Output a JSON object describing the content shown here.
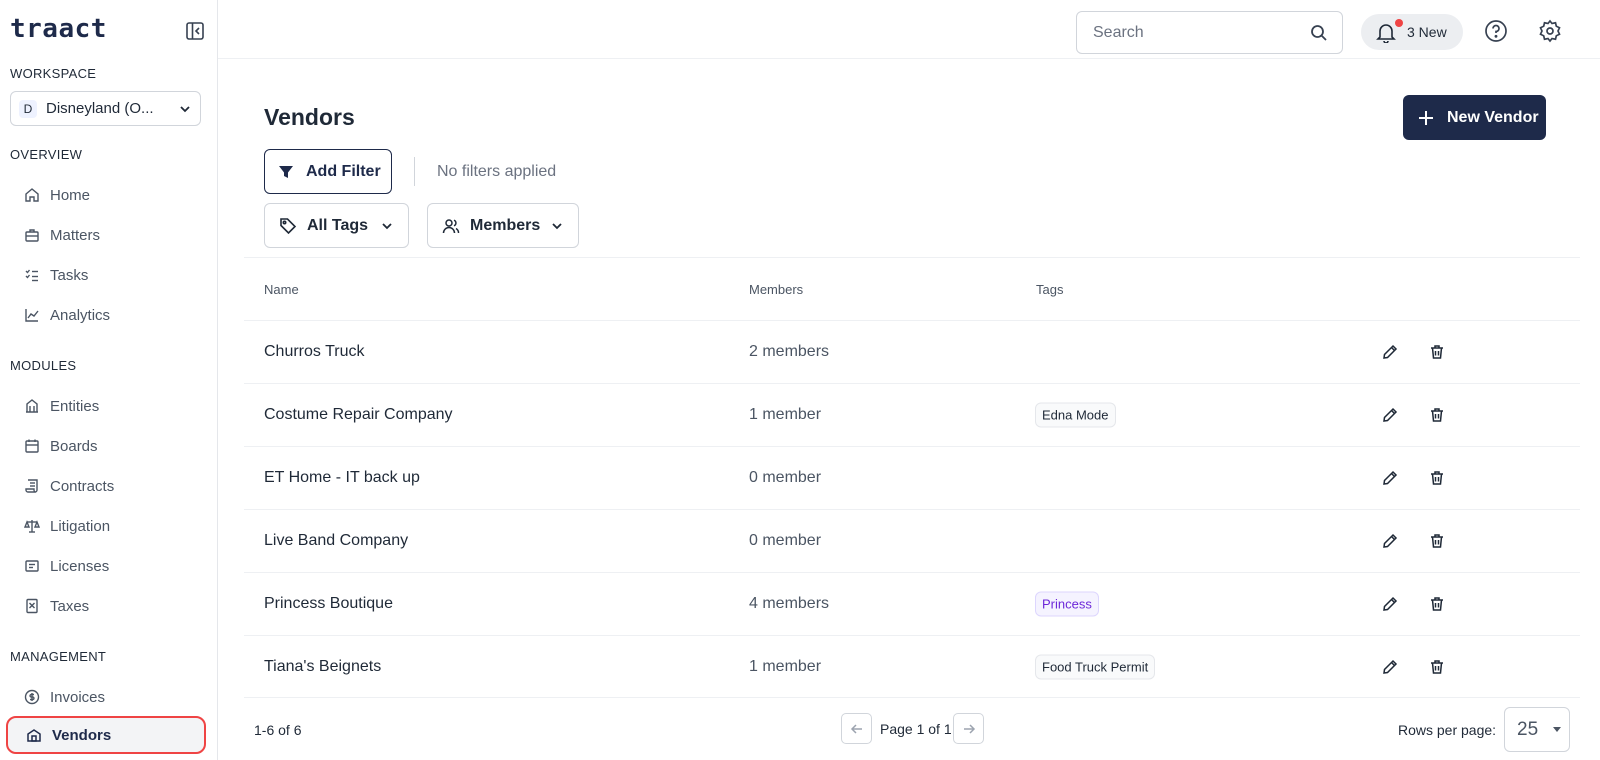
{
  "app": {
    "logo": "traact"
  },
  "sidebar": {
    "workspace_label": "WORKSPACE",
    "workspace": {
      "avatar": "D",
      "name": "Disneyland (O..."
    },
    "sections": {
      "overview": "OVERVIEW",
      "modules": "MODULES",
      "management": "MANAGEMENT"
    },
    "overview_items": [
      {
        "label": "Home",
        "icon": "home-icon"
      },
      {
        "label": "Matters",
        "icon": "briefcase-icon"
      },
      {
        "label": "Tasks",
        "icon": "list-checks-icon"
      },
      {
        "label": "Analytics",
        "icon": "chart-icon"
      }
    ],
    "module_items": [
      {
        "label": "Entities",
        "icon": "building-icon"
      },
      {
        "label": "Boards",
        "icon": "calendar-icon"
      },
      {
        "label": "Contracts",
        "icon": "scroll-icon"
      },
      {
        "label": "Litigation",
        "icon": "scale-icon"
      },
      {
        "label": "Licenses",
        "icon": "id-card-icon"
      },
      {
        "label": "Taxes",
        "icon": "calculator-icon"
      }
    ],
    "management_items": [
      {
        "label": "Invoices",
        "icon": "dollar-circle-icon"
      },
      {
        "label": "Vendors",
        "icon": "store-icon",
        "active": true
      }
    ]
  },
  "header": {
    "search_placeholder": "Search",
    "notifications_label": "3 New"
  },
  "main": {
    "title": "Vendors",
    "new_vendor_label": "New Vendor",
    "add_filter_label": "Add Filter",
    "no_filters_text": "No filters applied",
    "tags_dropdown_label": "All Tags",
    "members_dropdown_label": "Members"
  },
  "table": {
    "columns": [
      "Name",
      "Members",
      "Tags"
    ],
    "rows": [
      {
        "name": "Churros Truck",
        "members": "2 members",
        "tag": ""
      },
      {
        "name": "Costume Repair Company",
        "members": "1 member",
        "tag": "Edna Mode"
      },
      {
        "name": "ET Home - IT back up",
        "members": "0 member",
        "tag": ""
      },
      {
        "name": "Live Band Company",
        "members": "0 member",
        "tag": ""
      },
      {
        "name": "Princess Boutique",
        "members": "4 members",
        "tag": "Princess",
        "tag_color": "#6d28d9"
      },
      {
        "name": "Tiana's Beignets",
        "members": "1 member",
        "tag": "Food Truck Permit"
      }
    ]
  },
  "footer": {
    "count": "1-6 of 6",
    "page_label": "Page 1 of 1",
    "rows_per_page_label": "Rows per page:",
    "rows_per_page_value": "25"
  },
  "colors": {
    "primary": "#1e2a4a",
    "active_outline": "#ef4444",
    "notification_dot": "#ef4444"
  }
}
